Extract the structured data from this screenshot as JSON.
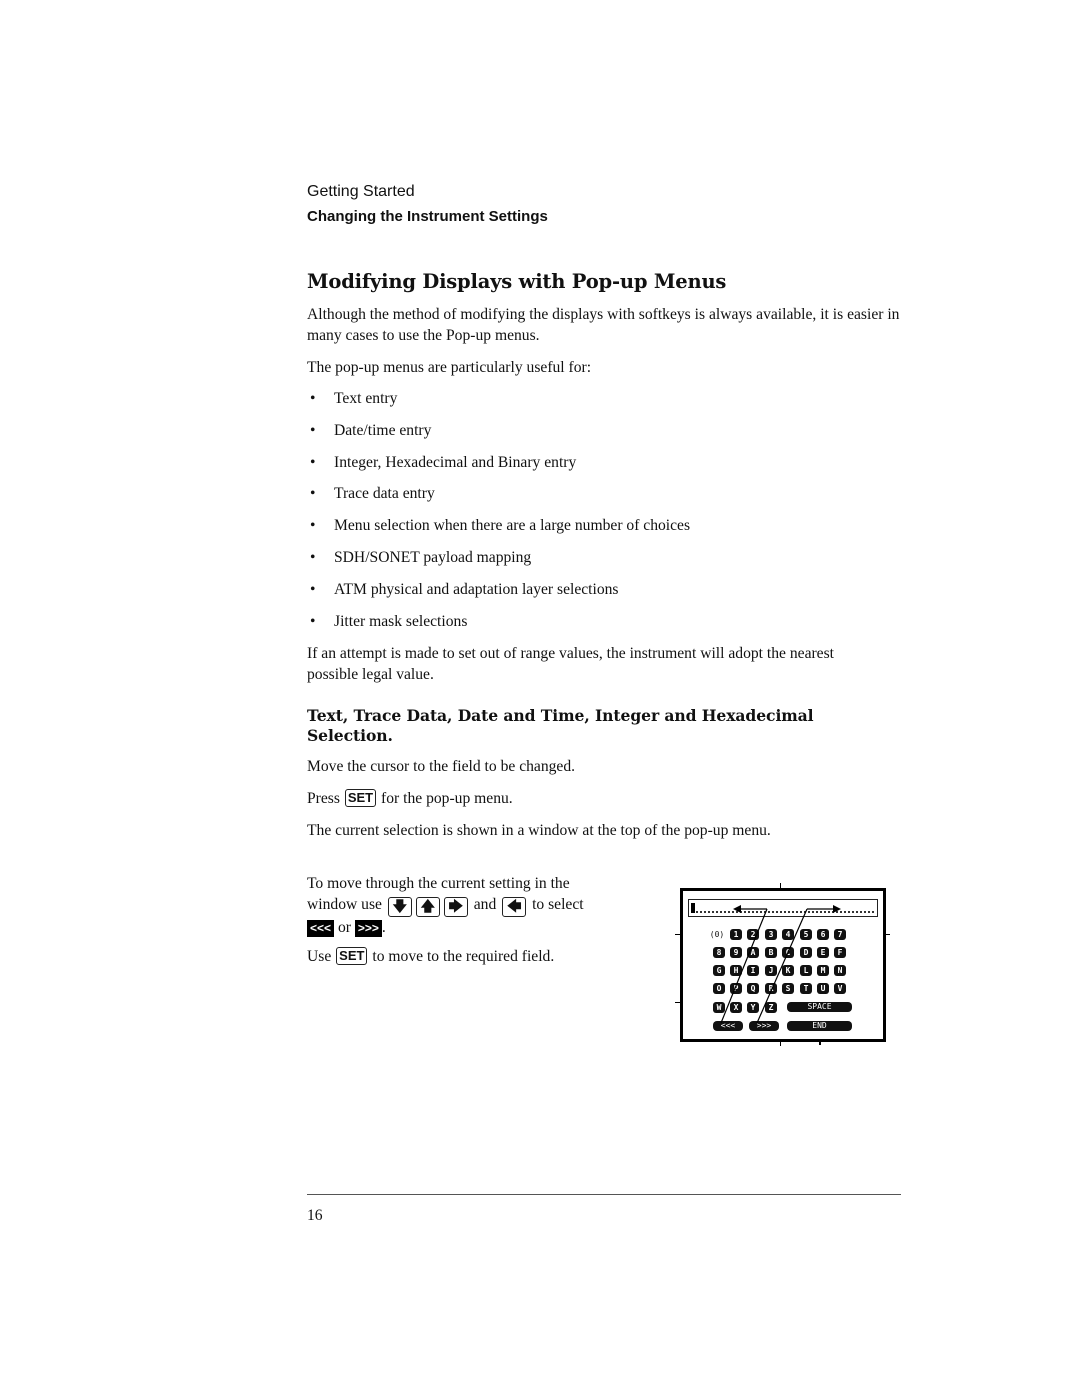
{
  "header": {
    "running_head": "Getting Started",
    "section": "Changing the Instrument Settings"
  },
  "title": "Modifying Displays with Pop-up Menus",
  "intro": "Although the method of modifying the displays with softkeys is always available, it is easier in many cases to use the Pop-up menus.",
  "list_intro": "The pop-up menus are particularly useful for:",
  "bullet_symbol": "•",
  "uses": [
    "Text entry",
    "Date/time entry",
    "Integer, Hexadecimal and Binary entry",
    "Trace data entry",
    "Menu selection when there are a large number of choices",
    "SDH/SONET payload mapping",
    "ATM physical and adaptation layer selections",
    "Jitter mask selections"
  ],
  "range_note": "If an attempt is made to set out of range values, the instrument will adopt the nearest possible legal value.",
  "subheading": "Text, Trace Data, Date and Time, Integer and Hexadecimal Selection.",
  "steps": {
    "move_cursor": "Move the cursor to the field to be changed.",
    "press_prefix": "Press",
    "press_suffix": "for the pop-up menu.",
    "current_selection": "The current selection is shown in a window at the top of the pop-up menu.",
    "move_through_1": "To move through the current setting in the",
    "move_through_2": "window use",
    "and_word": "and",
    "to_select": "to select",
    "or_word": "or",
    "period": ".",
    "use_prefix": "Use",
    "use_suffix": "to move to the required field."
  },
  "keys": {
    "set": "SET",
    "down": "🡇",
    "up": "🡅",
    "right": "🡆",
    "left": "🡄",
    "prev_softkey": "<<<",
    "next_softkey": ">>>"
  },
  "popup_menu": {
    "rows": [
      [
        "(0)",
        "1",
        "2",
        "3",
        "4",
        "5",
        "6",
        "7"
      ],
      [
        "8",
        "9",
        "A",
        "B",
        "C",
        "D",
        "E",
        "F"
      ],
      [
        "G",
        "H",
        "I",
        "J",
        "K",
        "L",
        "M",
        "N"
      ],
      [
        "O",
        "P",
        "Q",
        "R",
        "S",
        "T",
        "U",
        "V"
      ],
      [
        "W",
        "X",
        "Y",
        "Z"
      ]
    ],
    "space_label": "SPACE",
    "prev_label": "<<<",
    "next_label": ">>>",
    "end_label": "END"
  },
  "footer": {
    "page_number": "16"
  }
}
